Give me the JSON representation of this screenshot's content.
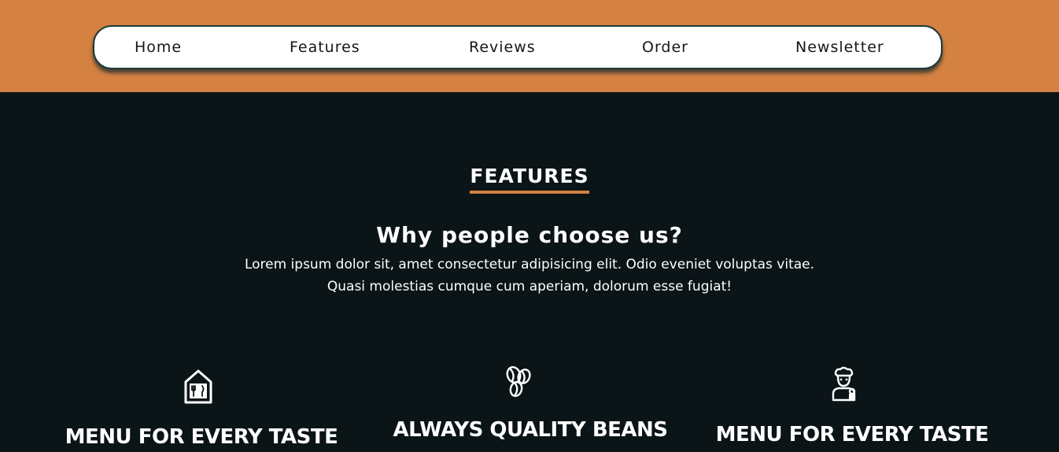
{
  "nav": {
    "items": [
      {
        "label": "Home"
      },
      {
        "label": "Features"
      },
      {
        "label": "Reviews"
      },
      {
        "label": "Order"
      },
      {
        "label": "Newsletter"
      }
    ]
  },
  "features_section": {
    "heading": "FEATURES",
    "subheading": "Why people choose us?",
    "lead_line_1": "Lorem ipsum dolor sit, amet consectetur adipisicing elit. Odio eveniet voluptas vitae.",
    "lead_line_2": "Quasi molestias cumque cum aperiam, dolorum esse fugiat!",
    "cards": [
      {
        "icon": "restaurant-house-icon",
        "title": "MENU FOR EVERY TASTE"
      },
      {
        "icon": "coffee-beans-icon",
        "title": "ALWAYS QUALITY BEANS"
      },
      {
        "icon": "chef-icon",
        "title": "MENU FOR EVERY TASTE"
      }
    ]
  },
  "colors": {
    "accent": "#d48142",
    "background": "#0b1416",
    "nav_bg": "#ffffff",
    "nav_border": "#1c3a3a",
    "text_light": "#ffffff",
    "text_dark": "#161616"
  }
}
